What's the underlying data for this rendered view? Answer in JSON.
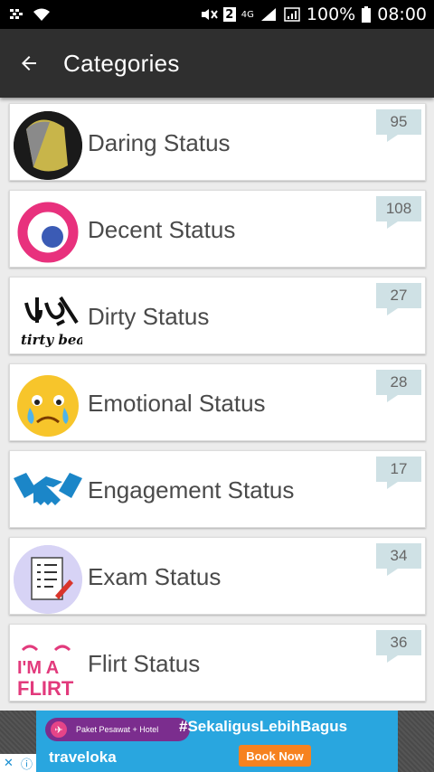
{
  "status_bar": {
    "battery": "100%",
    "time": "08:00",
    "sim_label": "2",
    "network": "4G"
  },
  "toolbar": {
    "title": "Categories"
  },
  "categories": [
    {
      "name": "Daring Status",
      "count": "95",
      "icon": "daring-avatar-icon"
    },
    {
      "name": "Decent Status",
      "count": "108",
      "icon": "decent-ring-icon"
    },
    {
      "name": "Dirty Status",
      "count": "27",
      "icon": "dirty-beat-logo-icon"
    },
    {
      "name": "Emotional Status",
      "count": "28",
      "icon": "crying-emoji-icon"
    },
    {
      "name": "Engagement Status",
      "count": "17",
      "icon": "handshake-icon"
    },
    {
      "name": "Exam Status",
      "count": "34",
      "icon": "checklist-icon"
    },
    {
      "name": "Flirt Status",
      "count": "36",
      "icon": "im-a-flirt-icon"
    }
  ],
  "ad": {
    "promo": "Paket Pesawat + Hotel",
    "hashtag": "#SekaligusLebihBagus",
    "brand": "traveloka",
    "cta": "Book Now"
  }
}
